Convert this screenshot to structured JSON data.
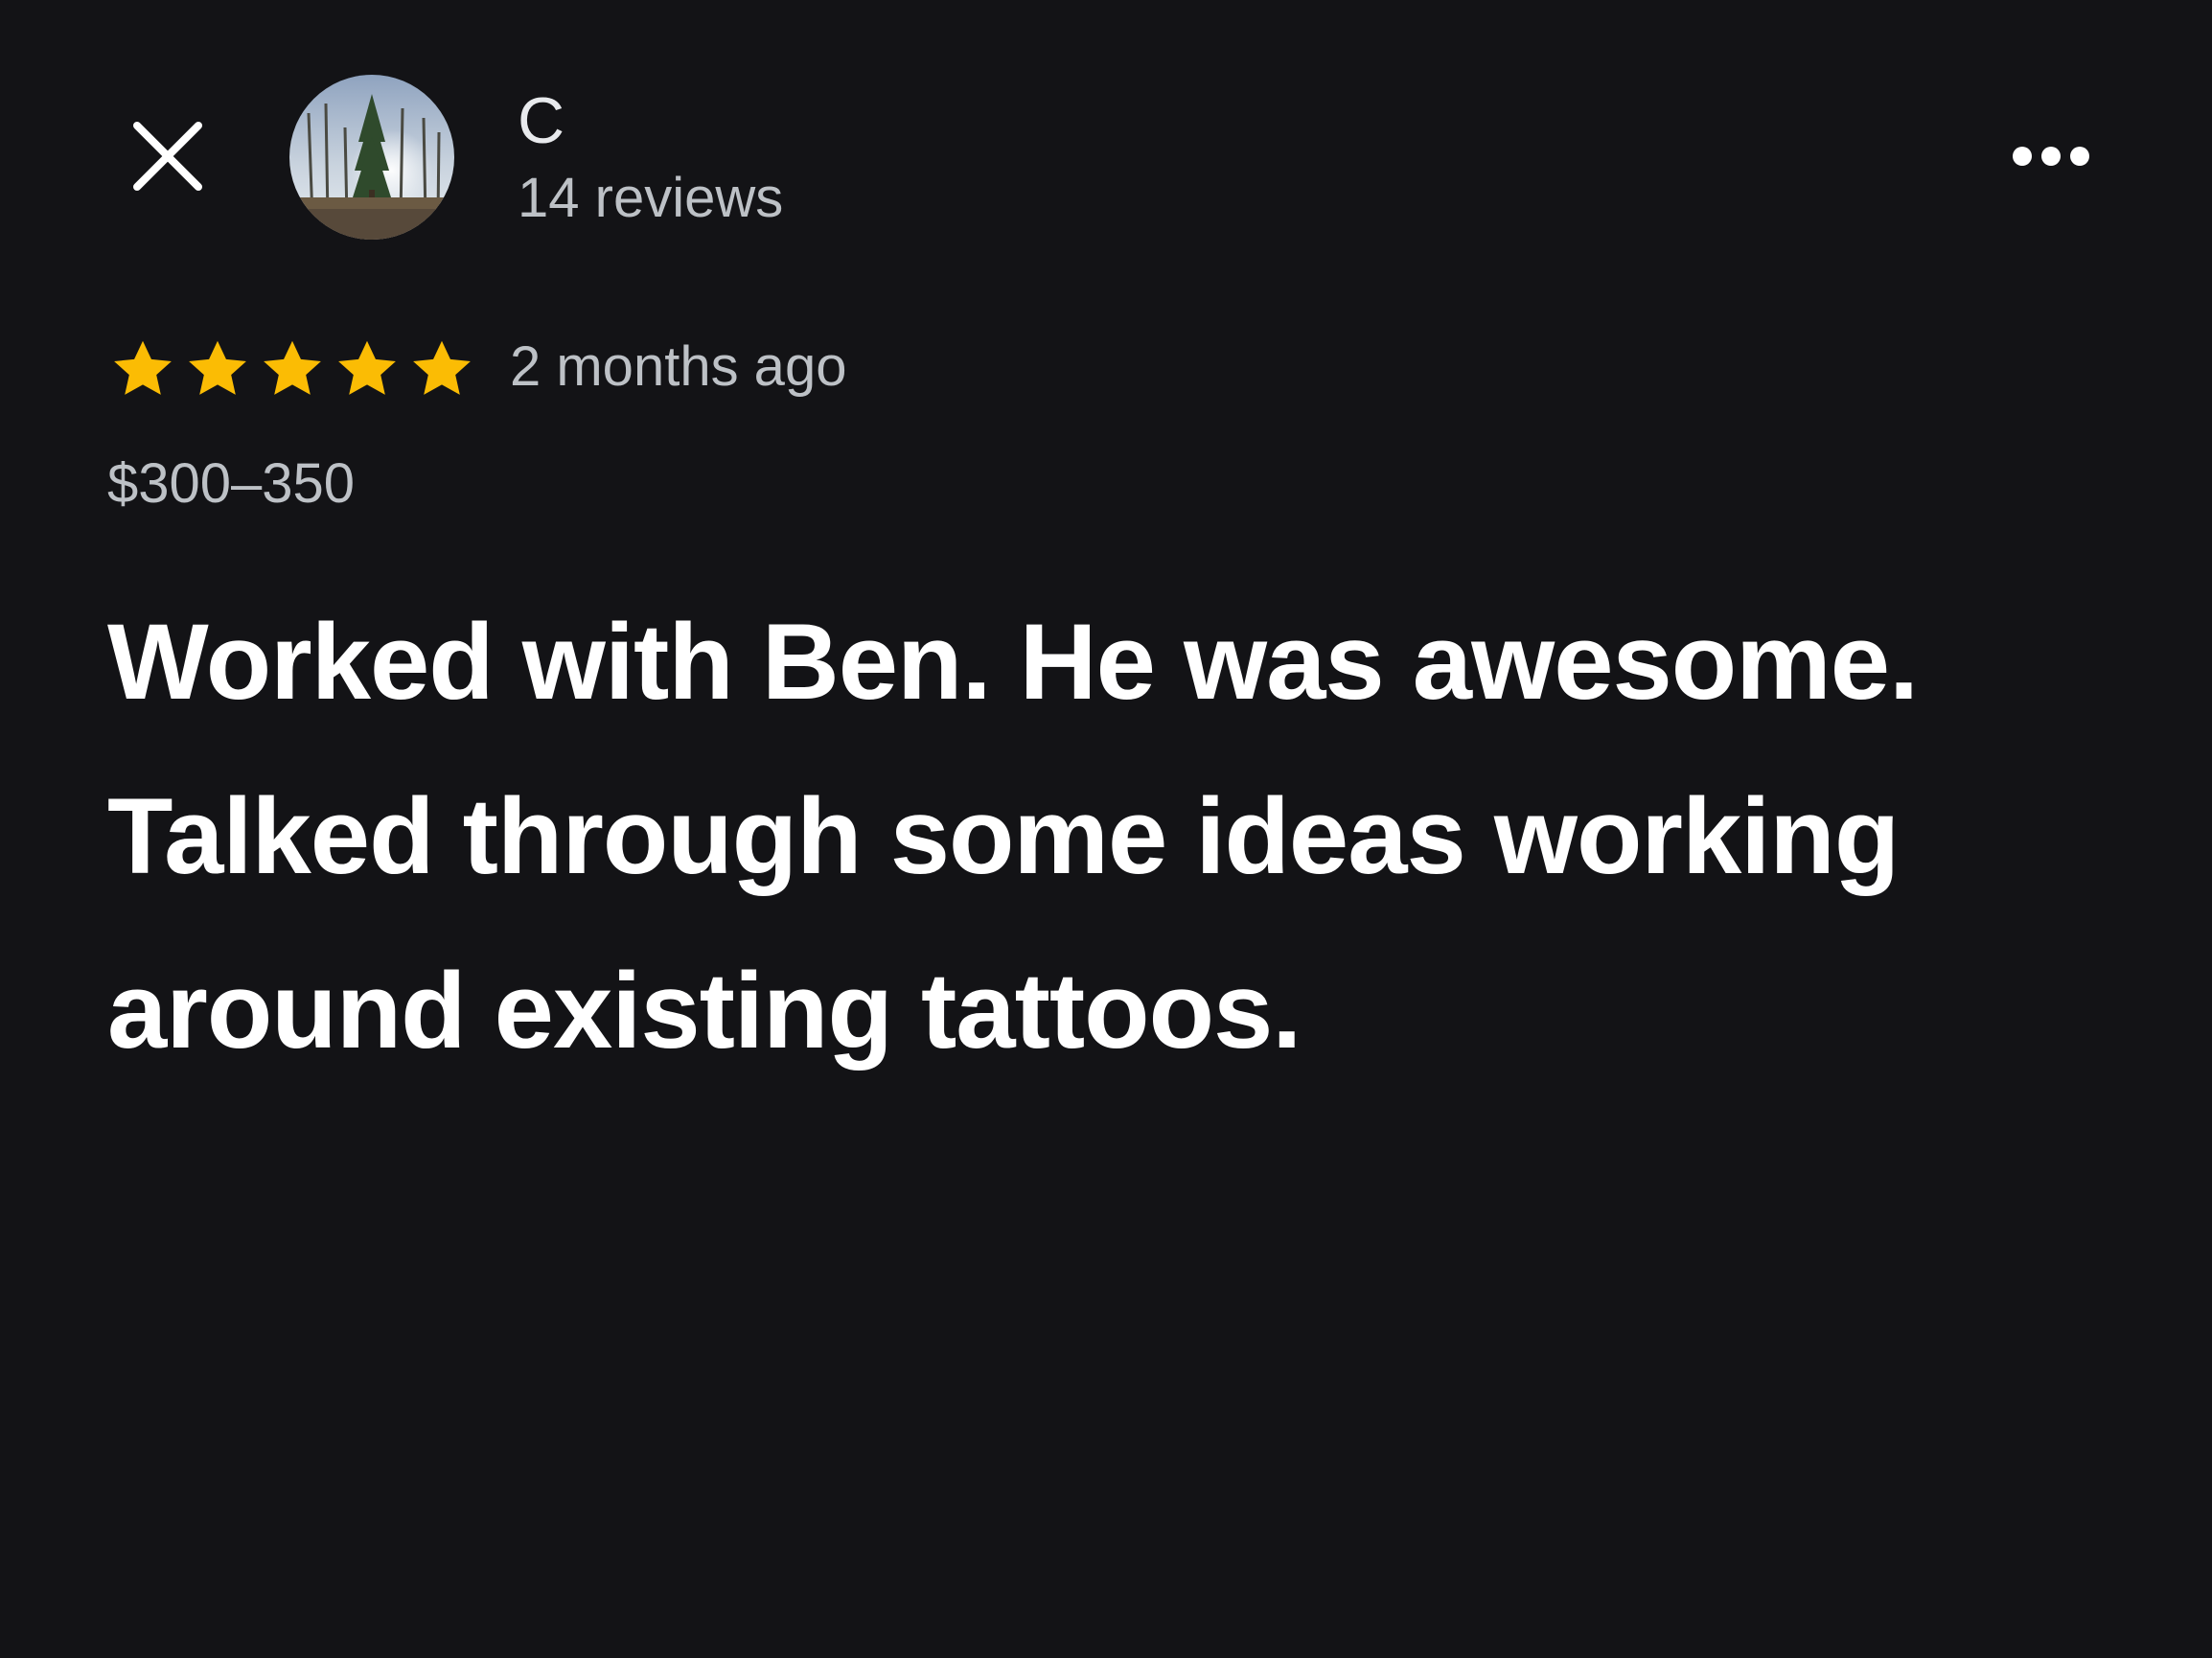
{
  "header": {
    "close_icon": "close-icon",
    "more_icon": "more-horizontal-icon",
    "author": {
      "name": "C",
      "review_count": "14 reviews",
      "avatar": "avatar-landscape-trees"
    }
  },
  "review": {
    "rating": 5,
    "max_rating": 5,
    "time_ago": "2 months ago",
    "price": "$300–350",
    "text": "Worked with Ben. He was awesome. Talked through some ideas working around existing tattoos."
  },
  "colors": {
    "background": "#131316",
    "star": "#fbbc04",
    "primary_text": "#ffffff",
    "secondary_text": "#bdc1c6"
  }
}
